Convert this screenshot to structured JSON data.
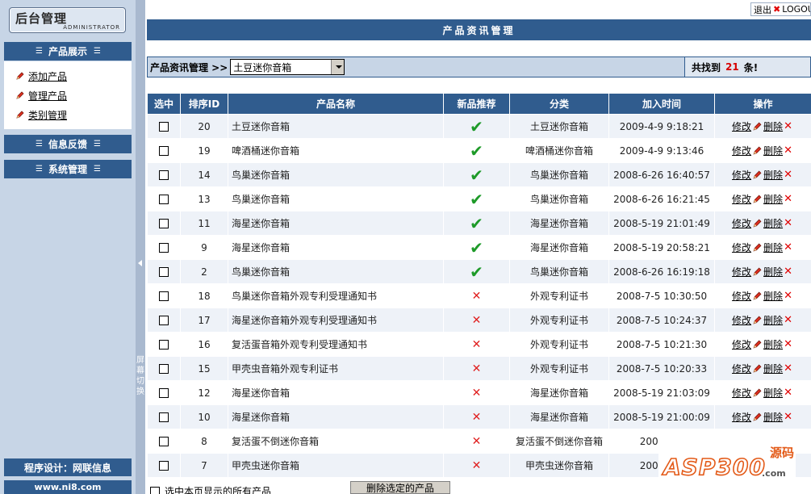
{
  "sidebar": {
    "logo_title": "后台管理",
    "logo_subtitle": "ADMINISTRATOR",
    "menu_product": "产品展示",
    "items": [
      {
        "label": "添加产品"
      },
      {
        "label": "管理产品"
      },
      {
        "label": "类别管理"
      }
    ],
    "menu_feedback": "信息反馈",
    "menu_system": "系统管理",
    "design_credit": "程序设计：网联信息",
    "site_url": "www.ni8.com"
  },
  "splitter_label": "屏幕切换",
  "logout": {
    "label_cn": "退出",
    "label_en": "LOGOUT"
  },
  "main": {
    "title": "产品资讯管理",
    "toolbar_label": "产品资讯管理 >>",
    "category_selected": "土豆迷你音箱",
    "found_prefix": "共找到",
    "found_count": "21",
    "found_suffix": "条!"
  },
  "columns": [
    "选中",
    "排序ID",
    "产品名称",
    "新品推荐",
    "分类",
    "加入时间",
    "操作"
  ],
  "rows": [
    {
      "id": "20",
      "name": "土豆迷你音箱",
      "recommended": true,
      "category": "土豆迷你音箱",
      "time": "2009-4-9 9:18:21"
    },
    {
      "id": "19",
      "name": "啤酒桶迷你音箱",
      "recommended": true,
      "category": "啤酒桶迷你音箱",
      "time": "2009-4-9 9:13:46"
    },
    {
      "id": "14",
      "name": "鸟巢迷你音箱",
      "recommended": true,
      "category": "鸟巢迷你音箱",
      "time": "2008-6-26 16:40:57"
    },
    {
      "id": "13",
      "name": "鸟巢迷你音箱",
      "recommended": true,
      "category": "鸟巢迷你音箱",
      "time": "2008-6-26 16:21:45"
    },
    {
      "id": "11",
      "name": "海星迷你音箱",
      "recommended": true,
      "category": "海星迷你音箱",
      "time": "2008-5-19 21:01:49"
    },
    {
      "id": "9",
      "name": "海星迷你音箱",
      "recommended": true,
      "category": "海星迷你音箱",
      "time": "2008-5-19 20:58:21"
    },
    {
      "id": "2",
      "name": "鸟巢迷你音箱",
      "recommended": true,
      "category": "鸟巢迷你音箱",
      "time": "2008-6-26 16:19:18"
    },
    {
      "id": "18",
      "name": "鸟巢迷你音箱外观专利受理通知书",
      "recommended": false,
      "category": "外观专利证书",
      "time": "2008-7-5 10:30:50"
    },
    {
      "id": "17",
      "name": "海星迷你音箱外观专利受理通知书",
      "recommended": false,
      "category": "外观专利证书",
      "time": "2008-7-5 10:24:37"
    },
    {
      "id": "16",
      "name": "复活蛋音箱外观专利受理通知书",
      "recommended": false,
      "category": "外观专利证书",
      "time": "2008-7-5 10:21:30"
    },
    {
      "id": "15",
      "name": "甲壳虫音箱外观专利证书",
      "recommended": false,
      "category": "外观专利证书",
      "time": "2008-7-5 10:20:33"
    },
    {
      "id": "12",
      "name": "海星迷你音箱",
      "recommended": false,
      "category": "海星迷你音箱",
      "time": "2008-5-19 21:03:09"
    },
    {
      "id": "10",
      "name": "海星迷你音箱",
      "recommended": false,
      "category": "海星迷你音箱",
      "time": "2008-5-19 21:00:09"
    },
    {
      "id": "8",
      "name": "复活蛋不倒迷你音箱",
      "recommended": false,
      "category": "复活蛋不倒迷你音箱",
      "time": "2008-3-2"
    },
    {
      "id": "7",
      "name": "甲壳虫迷你音箱",
      "recommended": false,
      "category": "甲壳虫迷你音箱",
      "time": "2007-11-"
    }
  ],
  "row_actions": {
    "edit": "修改",
    "delete": "删除"
  },
  "bottom": {
    "select_all_label": "选中本页显示的所有产品",
    "delete_button": "删除选定的产品"
  },
  "watermark": {
    "brand": "ASP300",
    "code": "源码",
    "site": ".com"
  },
  "colors": {
    "header_blue": "#305c8e",
    "sidebar_bg": "#c7d5e6",
    "accent_red": "#d60000",
    "check_green": "#1d9a28"
  }
}
